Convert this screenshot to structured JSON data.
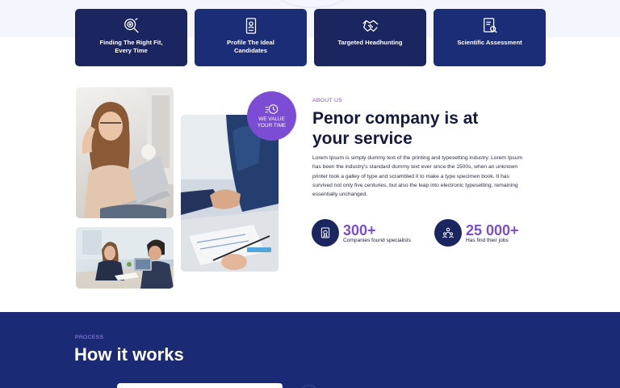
{
  "features": [
    {
      "label": "Finding The Right Fit, Every Time",
      "icon": "target-search-icon"
    },
    {
      "label": "Profile The Ideal Candidates",
      "icon": "profile-document-icon"
    },
    {
      "label": "Targeted Headhunting",
      "icon": "handshake-icon"
    },
    {
      "label": "Scientific Assessment",
      "icon": "assessment-document-icon"
    }
  ],
  "badge": {
    "text": "WE VALUE YOUR TIME",
    "icon": "speed-clock-icon"
  },
  "about": {
    "eyebrow": "ABOUT US",
    "title": "Penor company is at your service",
    "body": "Lorem Ipsum is simply dummy text of the printing and typesetting industry. Lorem Ipsum has been the industry's standard dummy text ever since the 1500s, when an unknown printer took a galley of type and scrambled it to make a type specimen book. It has survived not only five centuries, but also the leap into electronic typesetting, remaining essentially unchanged."
  },
  "stats": [
    {
      "value": "300+",
      "label": "Companies found specialists",
      "icon": "certificate-icon"
    },
    {
      "value": "25 000+",
      "label": "Has find their jobs",
      "icon": "people-group-icon"
    }
  ],
  "process": {
    "eyebrow": "PROCESS",
    "title": "How it works"
  },
  "colors": {
    "navy": "#1b2560",
    "blue": "#1c2d78",
    "accent": "#7c4dd4",
    "process_bg": "#1a2a74"
  }
}
